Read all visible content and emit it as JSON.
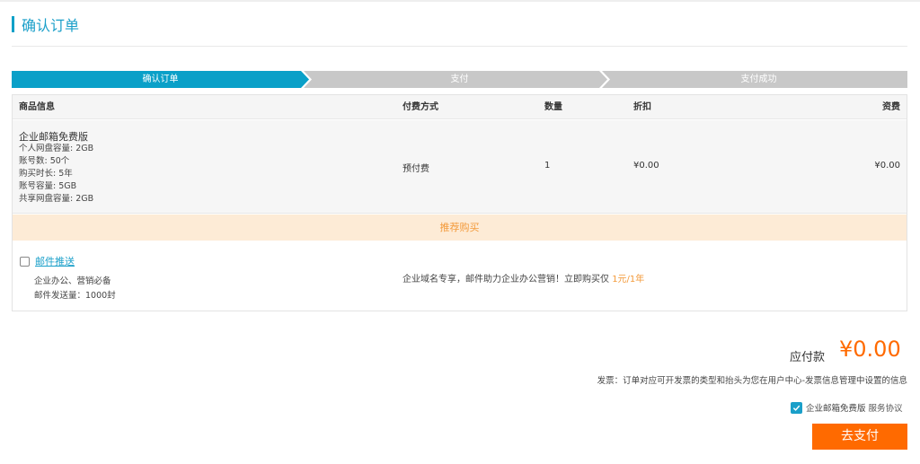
{
  "page": {
    "title": "确认订单"
  },
  "steps": [
    {
      "label": "确认订单",
      "active": true
    },
    {
      "label": "支付",
      "active": false
    },
    {
      "label": "支付成功",
      "active": false
    }
  ],
  "table": {
    "headers": {
      "product": "商品信息",
      "payment": "付费方式",
      "quantity": "数量",
      "discount": "折扣",
      "fee": "资费"
    },
    "row": {
      "name": "企业邮箱免费版",
      "details": [
        "个人网盘容量: 2GB",
        "账号数: 50个",
        "购买时长: 5年",
        "账号容量: 5GB",
        "共享网盘容量: 2GB"
      ],
      "payment": "预付费",
      "quantity": "1",
      "discount": "¥0.00",
      "fee": "¥0.00"
    }
  },
  "recommend": {
    "title": "推荐购买",
    "item": {
      "name": "邮件推送",
      "desc1": "企业办公、营销必备",
      "desc2": "邮件发送量：1000封",
      "promo_text": "企业域名专享，邮件助力企业办公营销！立即购买仅 ",
      "promo_price": "1元/1年"
    }
  },
  "summary": {
    "amount_label": "应付款",
    "amount_value": "¥0.00",
    "invoice_note": "发票：订单对应可开发票的类型和抬头为您在用户中心-发票信息管理中设置的信息",
    "agree_product": "企业邮箱免费版",
    "agree_link": "服务协议",
    "pay_button": "去支付"
  },
  "colors": {
    "accent": "#1a9fc9",
    "step_active": "#0aa0c8",
    "step_inactive": "#c8c8c8",
    "orange": "#ff6a00",
    "recommend_bg": "#fdebd6"
  }
}
